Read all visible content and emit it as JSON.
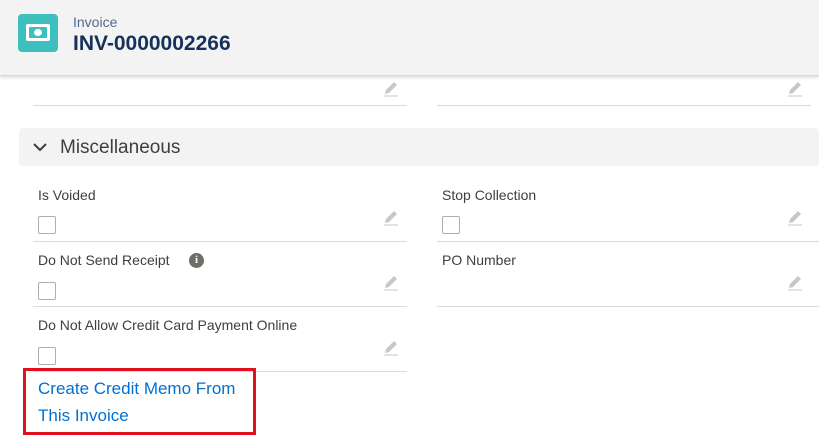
{
  "header": {
    "object_type": "Invoice",
    "record_name": "INV-0000002266",
    "icon": "invoice-icon",
    "accent_color": "#3dbfbe"
  },
  "section": {
    "title": "Miscellaneous",
    "expanded": true
  },
  "fields": {
    "is_voided": {
      "label": "Is Voided",
      "checked": false
    },
    "stop_collection": {
      "label": "Stop Collection",
      "checked": false
    },
    "do_not_send_receipt": {
      "label": "Do Not Send Receipt",
      "checked": false
    },
    "po_number": {
      "label": "PO Number",
      "value": ""
    },
    "do_not_allow_cc": {
      "label": "Do Not Allow Credit Card Payment Online",
      "checked": false
    }
  },
  "link": {
    "line1": "Create Credit Memo From",
    "line2": "This Invoice"
  },
  "highlight_color": "#e0101f"
}
